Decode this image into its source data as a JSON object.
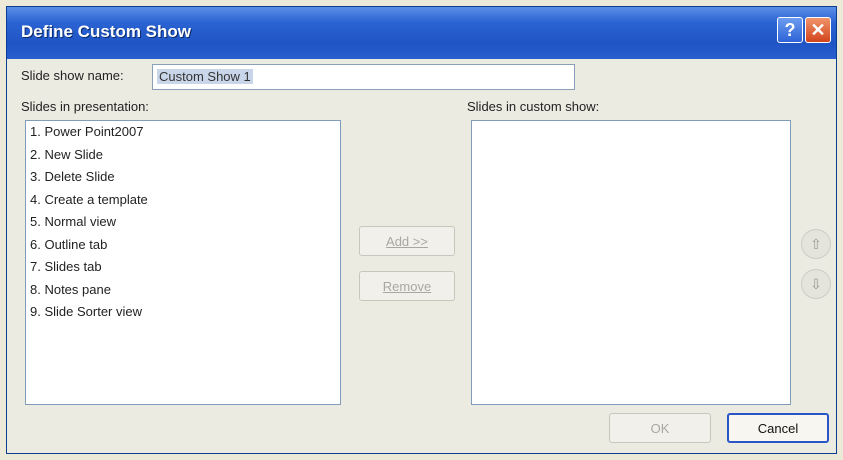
{
  "dialog": {
    "title": "Define Custom Show",
    "help_label": "?",
    "close_label": "✕"
  },
  "name": {
    "label": "Slide show name:",
    "value": "Custom Show 1"
  },
  "left_list": {
    "label": "Slides in presentation:",
    "items": [
      "1. Power Point2007",
      "2. New Slide",
      "3. Delete Slide",
      "4. Create a template",
      "5. Normal view",
      "6. Outline tab",
      "7. Slides tab",
      "8. Notes pane",
      "9. Slide Sorter view"
    ]
  },
  "right_list": {
    "label": "Slides in custom show:",
    "items": []
  },
  "buttons": {
    "add": "Add >>",
    "remove": "Remove",
    "move_up": "⇧",
    "move_down": "⇩",
    "ok": "OK",
    "cancel": "Cancel"
  }
}
